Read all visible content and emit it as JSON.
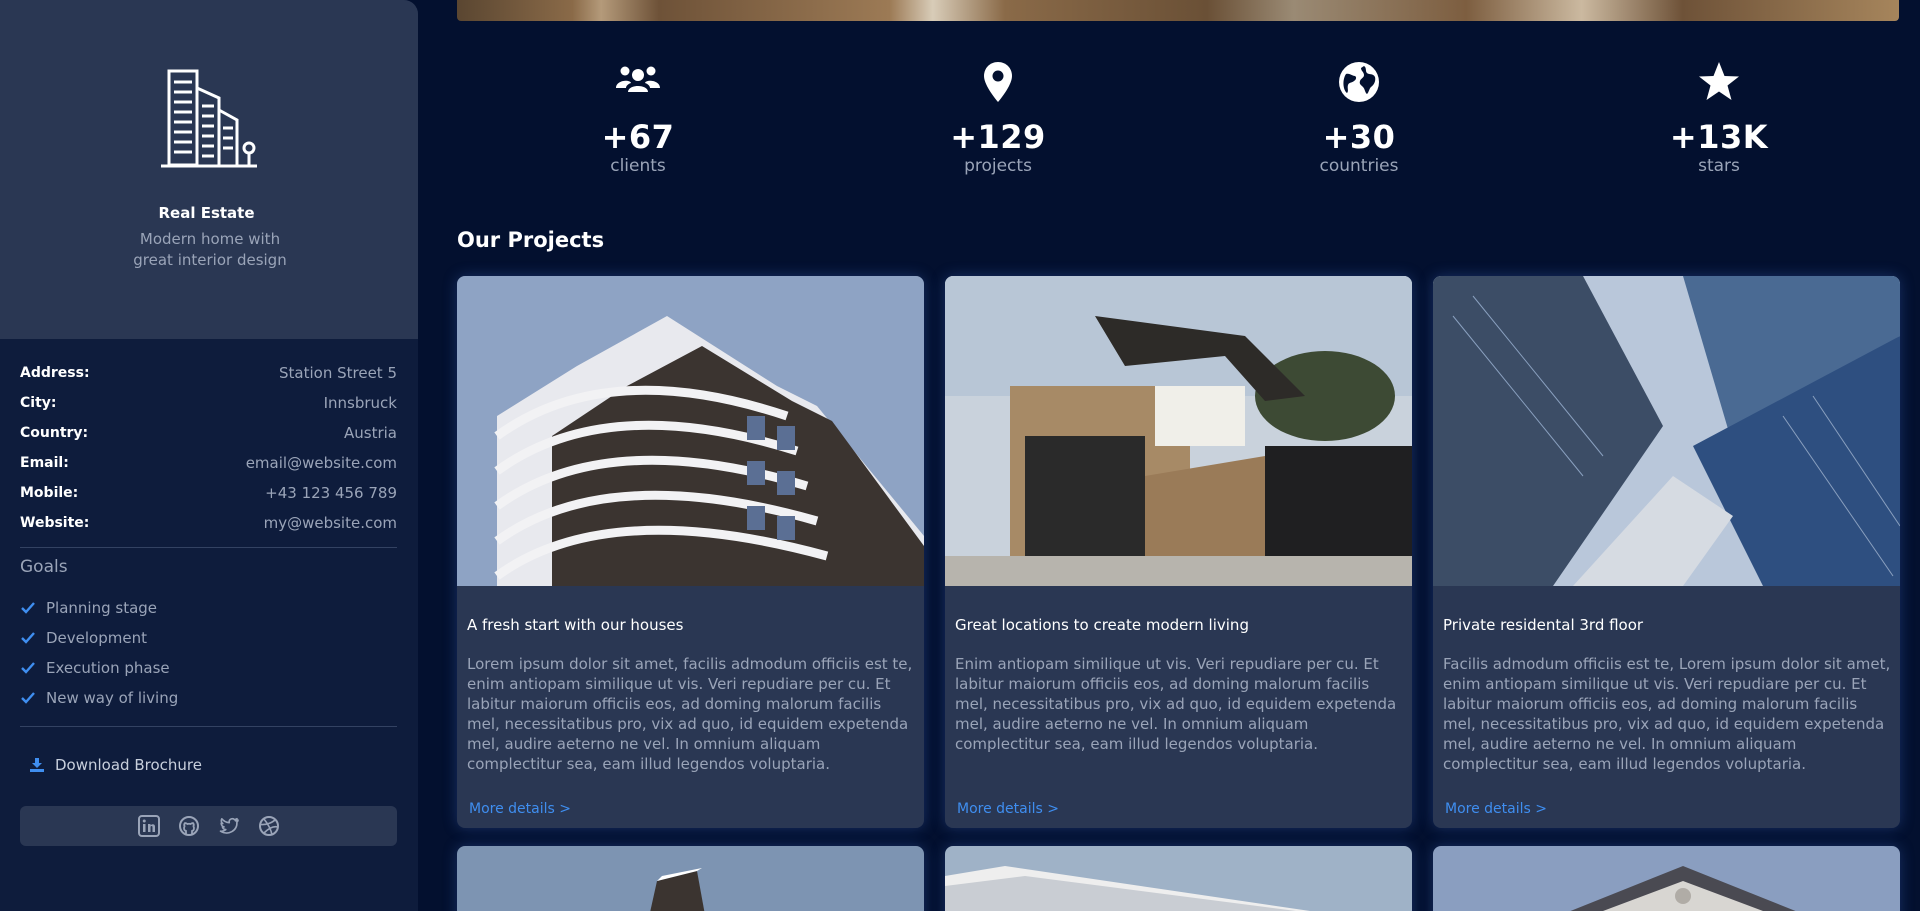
{
  "profile": {
    "icon": "building-icon",
    "name": "Real Estate",
    "tagline": "Modern home with great interior design"
  },
  "info": [
    {
      "label": "Address:",
      "value": "Station Street 5"
    },
    {
      "label": "City:",
      "value": "Innsbruck"
    },
    {
      "label": "Country:",
      "value": "Austria"
    },
    {
      "label": "Email:",
      "value": "email@website.com"
    },
    {
      "label": "Mobile:",
      "value": "+43 123 456 789"
    },
    {
      "label": "Website:",
      "value": "my@website.com"
    }
  ],
  "goals": {
    "title": "Goals",
    "items": [
      "Planning stage",
      "Development",
      "Execution phase",
      "New way of living"
    ]
  },
  "download": {
    "label": "Download Brochure",
    "icon": "download-icon"
  },
  "social": [
    "linkedin-icon",
    "github-icon",
    "twitter-icon",
    "dribbble-icon"
  ],
  "stats": [
    {
      "icon": "users-icon",
      "number": "+67",
      "label": "clients"
    },
    {
      "icon": "map-pin-icon",
      "number": "+129",
      "label": "projects"
    },
    {
      "icon": "globe-icon",
      "number": "+30",
      "label": "countries"
    },
    {
      "icon": "star-icon",
      "number": "+13K",
      "label": "stars"
    }
  ],
  "projects": {
    "title": "Our Projects",
    "cards": [
      {
        "title": "A fresh start with our houses",
        "text": "Lorem ipsum dolor sit amet, facilis admodum officiis est te, enim antiopam similique ut vis. Veri repudiare per cu. Et labitur maiorum officiis eos, ad doming malorum facilis mel, necessitatibus pro, vix ad quo, id equidem expetenda mel, audire aeterno ne vel. In omnium aliquam complectitur sea, eam illud legendos voluptaria.",
        "link": "More details >"
      },
      {
        "title": "Great locations to create modern living",
        "text": "Enim antiopam similique ut vis. Veri repudiare per cu. Et labitur maiorum officiis eos, ad doming malorum facilis mel, necessitatibus pro, vix ad quo, id equidem expetenda mel, audire aeterno ne vel. In omnium aliquam complectitur sea, eam illud legendos voluptaria.",
        "link": "More details >"
      },
      {
        "title": "Private residental 3rd floor",
        "text": "Facilis admodum officiis est te, Lorem ipsum dolor sit amet, enim antiopam similique ut vis. Veri repudiare per cu. Et labitur maiorum officiis eos, ad doming malorum facilis mel, necessitatibus pro, vix ad quo, id equidem expetenda mel, audire aeterno ne vel. In omnium aliquam complectitur sea, eam illud legendos voluptaria.",
        "link": "More details >"
      }
    ]
  },
  "colors": {
    "background": "#03102f",
    "sidebar": "#0e1c3c",
    "card": "#2a3753",
    "accent": "#3f8ef0",
    "muted_text": "#9aa4b8"
  }
}
